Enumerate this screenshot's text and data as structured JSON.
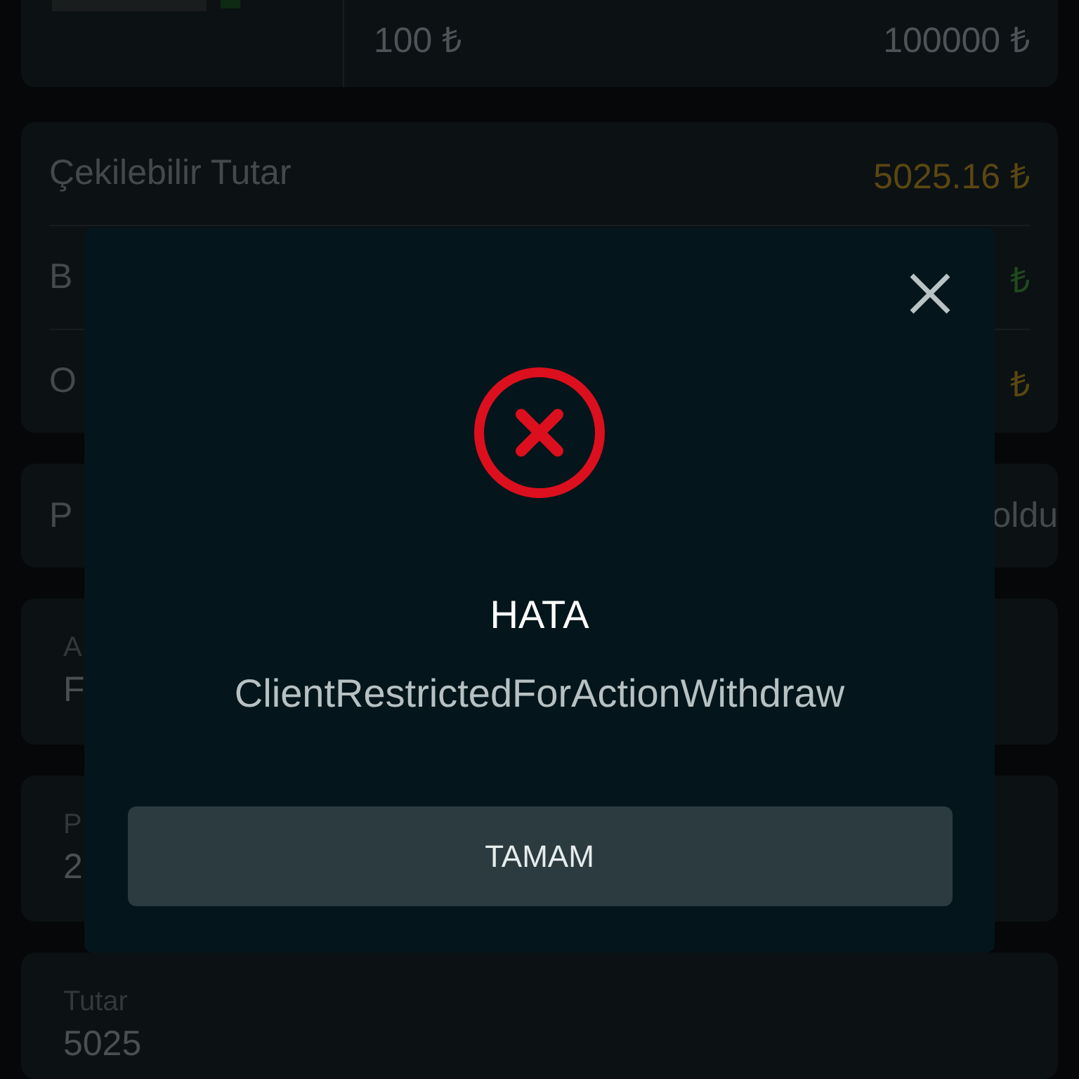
{
  "limits": {
    "min": "100 ₺",
    "max": "100000 ₺"
  },
  "balances": [
    {
      "label": "Çekilebilir Tutar",
      "value": "5025.16 ₺",
      "color": "#5a4712"
    },
    {
      "label": "B",
      "value": "₺",
      "color": "#1f4a1f"
    },
    {
      "label": "O",
      "value": "₺",
      "color": "#5a4712"
    }
  ],
  "fields": [
    {
      "kind": "inline",
      "label": "P",
      "value": "oldu"
    },
    {
      "kind": "stacked",
      "label": "A",
      "value": "F"
    },
    {
      "kind": "stacked",
      "label": "P",
      "value": "2"
    },
    {
      "kind": "stacked",
      "label": "Tutar",
      "value": "5025"
    }
  ],
  "dialog": {
    "title": "HATA",
    "message": "ClientRestrictedForActionWithdraw",
    "button": "TAMAM"
  }
}
